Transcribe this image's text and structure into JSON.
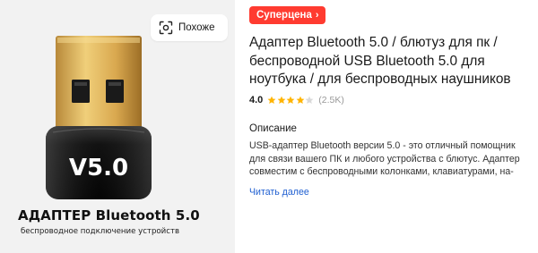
{
  "colors": {
    "badge_bg": "#ff3b30",
    "star": "#ffb400",
    "link": "#1f5fd1",
    "image_bg": "#f2f2f2"
  },
  "image": {
    "similar_label": "Похоже",
    "device_label": "V5.0",
    "caption_title": "АДАПТЕР Bluetooth 5.0",
    "caption_subtitle": "беспроводное подключение устройств"
  },
  "product": {
    "badge_label": "Суперцена",
    "badge_icon": "chevron-right-icon",
    "title": "Адаптер Bluetooth 5.0 / блютуз для пк / беспроводной USB Bluetooth 5.0 для ноутбука / для беспроводных наушников",
    "rating": {
      "score": "4.0",
      "stars_filled": 4,
      "stars_total": 5,
      "count": "(2.5K)"
    },
    "description": {
      "heading": "Описание",
      "text": "USB-адаптер Bluetooth версии 5.0 - это отличный помощник для связи вашего ПК и любого устройства с блютус. Адаптер совместим с беспроводными колонками, клавиатурами, на-",
      "read_more": "Читать далее"
    }
  }
}
